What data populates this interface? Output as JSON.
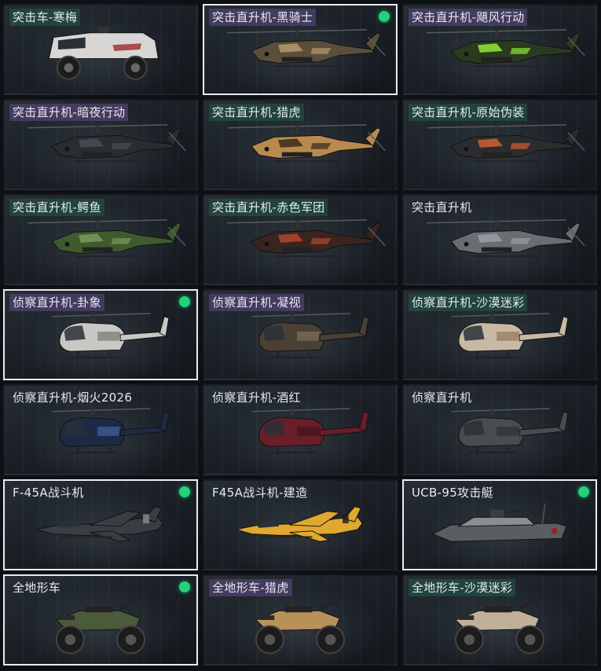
{
  "items": [
    {
      "label": "突击车-寒梅",
      "tag": "green",
      "selected": false,
      "owned": false,
      "kind": "truck",
      "color": "#d8d6d4",
      "accent": "#9a2a2a"
    },
    {
      "label": "突击直升机-黑骑士",
      "tag": "purple",
      "selected": true,
      "owned": true,
      "kind": "attack-heli",
      "color": "#5a4e3c",
      "accent": "#b89a6a"
    },
    {
      "label": "突击直升机-飓风行动",
      "tag": "purple",
      "selected": false,
      "owned": false,
      "kind": "attack-heli",
      "color": "#2b3a1f",
      "accent": "#8fe83a"
    },
    {
      "label": "突击直升机-暗夜行动",
      "tag": "purple",
      "selected": false,
      "owned": false,
      "kind": "attack-heli",
      "color": "#2a2d30",
      "accent": "#4a4f55"
    },
    {
      "label": "突击直升机-猎虎",
      "tag": "green",
      "selected": false,
      "owned": false,
      "kind": "attack-heli",
      "color": "#b88a4e",
      "accent": "#3a2a1a"
    },
    {
      "label": "突击直升机-原始伪装",
      "tag": "green",
      "selected": false,
      "owned": false,
      "kind": "attack-heli",
      "color": "#2a2c2e",
      "accent": "#d06030"
    },
    {
      "label": "突击直升机-鳄鱼",
      "tag": "green",
      "selected": false,
      "owned": false,
      "kind": "attack-heli",
      "color": "#3f5a2c",
      "accent": "#7a9a5a"
    },
    {
      "label": "突击直升机-赤色军团",
      "tag": "green",
      "selected": false,
      "owned": false,
      "kind": "attack-heli",
      "color": "#3a2420",
      "accent": "#b0482c"
    },
    {
      "label": "突击直升机",
      "tag": "none",
      "selected": false,
      "owned": false,
      "kind": "attack-heli",
      "color": "#6a6e72",
      "accent": "#9a9ea2"
    },
    {
      "label": "侦察直升机-卦象",
      "tag": "purple",
      "selected": true,
      "owned": true,
      "kind": "scout-heli",
      "color": "#c8c8c4",
      "accent": "#6a6a66"
    },
    {
      "label": "侦察直升机-凝视",
      "tag": "purple",
      "selected": false,
      "owned": false,
      "kind": "scout-heli",
      "color": "#4a4036",
      "accent": "#8a7a66"
    },
    {
      "label": "侦察直升机-沙漠迷彩",
      "tag": "green",
      "selected": false,
      "owned": false,
      "kind": "scout-heli",
      "color": "#c8b8a4",
      "accent": "#8a6a52"
    },
    {
      "label": "侦察直升机-烟火2026",
      "tag": "none",
      "selected": false,
      "owned": false,
      "kind": "scout-heli",
      "color": "#1e2a44",
      "accent": "#4a6ab0"
    },
    {
      "label": "侦察直升机-酒红",
      "tag": "none",
      "selected": false,
      "owned": false,
      "kind": "scout-heli",
      "color": "#6a1e2a",
      "accent": "#3a1218"
    },
    {
      "label": "侦察直升机",
      "tag": "none",
      "selected": false,
      "owned": false,
      "kind": "scout-heli",
      "color": "#4a4c4e",
      "accent": "#2a2c2e"
    },
    {
      "label": "F-45A战斗机",
      "tag": "none",
      "selected": true,
      "owned": true,
      "kind": "jet",
      "color": "#3a3e44",
      "accent": "#8a8e94"
    },
    {
      "label": "F45A战斗机-建造",
      "tag": "none",
      "selected": false,
      "owned": false,
      "kind": "jet",
      "color": "#e0a830",
      "accent": "#1a1a1a"
    },
    {
      "label": "UCB-95攻击艇",
      "tag": "none",
      "selected": true,
      "owned": true,
      "kind": "boat",
      "color": "#5a5e62",
      "accent": "#8a8e92"
    },
    {
      "label": "全地形车",
      "tag": "none",
      "selected": true,
      "owned": true,
      "kind": "atv",
      "color": "#4a5a3a",
      "accent": "#2a2a2a"
    },
    {
      "label": "全地形车-猎虎",
      "tag": "purple",
      "selected": false,
      "owned": false,
      "kind": "atv",
      "color": "#b8905a",
      "accent": "#2a2a2a"
    },
    {
      "label": "全地形车-沙漠迷彩",
      "tag": "green",
      "selected": false,
      "owned": false,
      "kind": "atv",
      "color": "#c0b09a",
      "accent": "#2a2a2a"
    }
  ]
}
